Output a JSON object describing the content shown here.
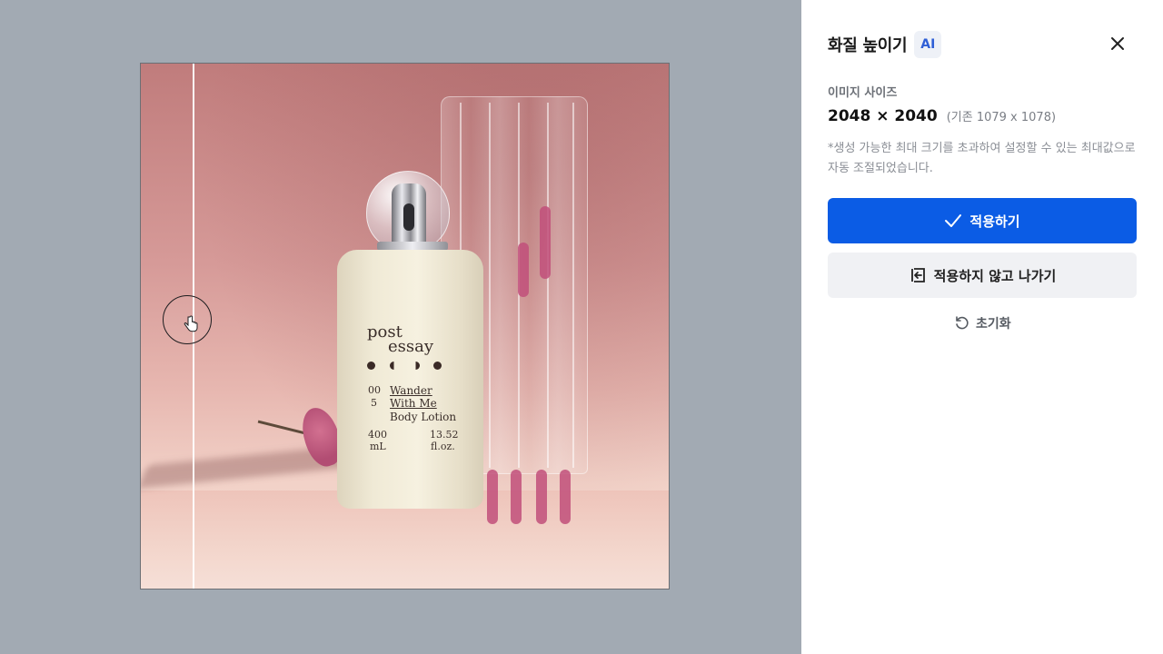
{
  "panel": {
    "title": "화질 높이기",
    "badge": "AI",
    "image_size_label": "이미지 사이즈",
    "size_value": "2048 × 2040",
    "original_size": "(기존 1079 x 1078)",
    "note": "*생성 가능한 최대 크기를 초과하여 설정할 수 있는 최대값으로 자동 조절되었습니다.",
    "apply_label": "적용하기",
    "exit_label": "적용하지 않고 나가기",
    "reset_label": "초기화"
  },
  "product": {
    "brand_line1": "post",
    "brand_line2": "essay",
    "number_top": "00",
    "number_bottom": "5",
    "name_line1": "Wander",
    "name_line2": "With Me",
    "name_line3": "Body Lotion",
    "volume_ml": "400",
    "unit_ml": "mL",
    "volume_oz": "13.52",
    "unit_oz": "fl.oz."
  },
  "colors": {
    "accent": "#0b5ce5",
    "canvas_bg": "#a2aab3",
    "panel_bg": "#ffffff",
    "secondary_btn": "#f0f1f4"
  },
  "icons": {
    "close": "close-icon",
    "apply": "check-icon",
    "exit": "exit-icon",
    "reset": "reset-icon",
    "cursor": "hand-pointer-icon"
  }
}
